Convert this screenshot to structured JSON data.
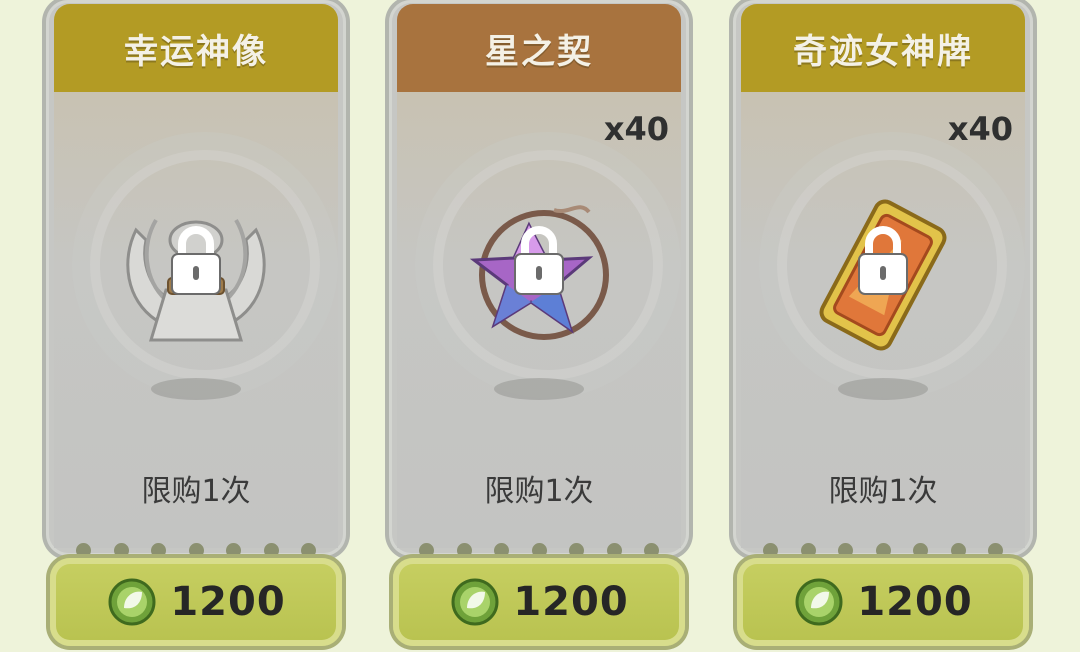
{
  "shop": {
    "items": [
      {
        "name": "幸运神像",
        "quantity": "",
        "limit": "限购1次",
        "price": "1200",
        "header_color": "#b39b24",
        "icon": "winged-statue-icon",
        "locked": true
      },
      {
        "name": "星之契",
        "quantity": "x40",
        "limit": "限购1次",
        "price": "1200",
        "header_color": "#a8733e",
        "icon": "star-crystal-icon",
        "locked": true
      },
      {
        "name": "奇迹女神牌",
        "quantity": "x40",
        "limit": "限购1次",
        "price": "1200",
        "header_color": "#b39b24",
        "icon": "goddess-card-icon",
        "locked": true
      }
    ],
    "currency_icon": "leaf-gem-icon"
  }
}
